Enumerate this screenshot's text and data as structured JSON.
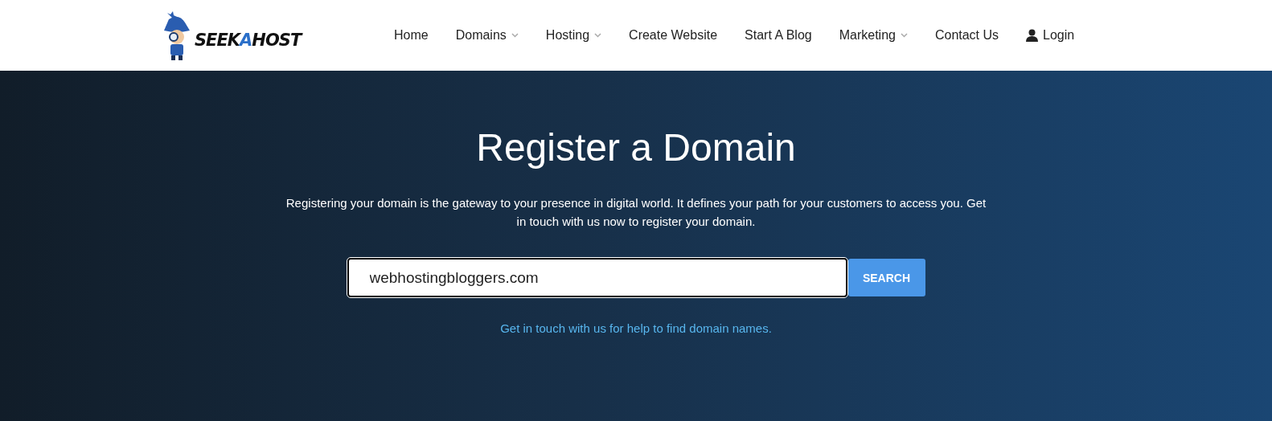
{
  "logo": {
    "parts": [
      {
        "text": "SEEK",
        "color": "#111111"
      },
      {
        "text": "A",
        "color": "#2a6fc9"
      },
      {
        "text": "HOST",
        "color": "#111111"
      }
    ]
  },
  "nav": [
    {
      "label": "Home",
      "dropdown": false,
      "kind": "link"
    },
    {
      "label": "Domains",
      "dropdown": true,
      "kind": "link"
    },
    {
      "label": "Hosting",
      "dropdown": true,
      "kind": "link"
    },
    {
      "label": "Create Website",
      "dropdown": false,
      "kind": "link"
    },
    {
      "label": "Start A Blog",
      "dropdown": false,
      "kind": "link"
    },
    {
      "label": "Marketing",
      "dropdown": true,
      "kind": "link"
    },
    {
      "label": "Contact Us",
      "dropdown": false,
      "kind": "link"
    },
    {
      "label": "Login",
      "dropdown": false,
      "kind": "account"
    }
  ],
  "hero": {
    "title": "Register a Domain",
    "description": "Registering your domain is the gateway to your presence in digital world. It defines your path for your customers to access you. Get in touch with us now to register your domain.",
    "search": {
      "value": "webhostingbloggers.com",
      "button": "SEARCH"
    },
    "help_link": "Get in touch with us for help to find domain names."
  }
}
